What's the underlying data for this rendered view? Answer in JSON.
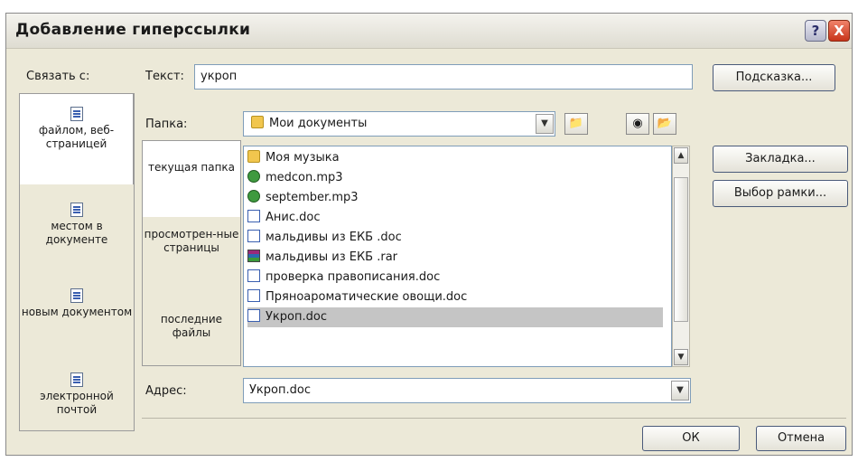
{
  "window": {
    "title": "Добавление гиперссылки",
    "help_glyph": "?",
    "close_glyph": "X"
  },
  "link_to": {
    "label": "Связать с:",
    "items": [
      {
        "label": "файлом, веб-страницей",
        "icon": "web-page-icon",
        "selected": true
      },
      {
        "label": "местом в документе",
        "icon": "place-in-document-icon",
        "selected": false
      },
      {
        "label": "новым документом",
        "icon": "new-document-icon",
        "selected": false
      },
      {
        "label": "электронной почтой",
        "icon": "email-icon",
        "selected": false
      }
    ]
  },
  "text_field": {
    "label": "Текст:",
    "value": "укроп"
  },
  "folder": {
    "label": "Папка:",
    "value": "Мои документы"
  },
  "favorites": [
    {
      "label": "текущая папка",
      "selected": true
    },
    {
      "label": "просмотрен-ные страницы",
      "selected": false
    },
    {
      "label": "последние файлы",
      "selected": false
    }
  ],
  "files": [
    {
      "name": "Моя музыка",
      "type": "folder"
    },
    {
      "name": "medcon.mp3",
      "type": "mp3"
    },
    {
      "name": "september.mp3",
      "type": "mp3"
    },
    {
      "name": "Анис.doc",
      "type": "doc"
    },
    {
      "name": "мальдивы из ЕКБ .doc",
      "type": "doc"
    },
    {
      "name": "мальдивы из ЕКБ .rar",
      "type": "rar"
    },
    {
      "name": "проверка правописания.doc",
      "type": "doc"
    },
    {
      "name": "Пряноароматические овощи.doc",
      "type": "doc"
    },
    {
      "name": "Укроп.doc",
      "type": "doc",
      "selected": true
    }
  ],
  "address": {
    "label": "Адрес:",
    "value": "Укроп.doc"
  },
  "buttons": {
    "hint": "Подсказка...",
    "bookmark": "Закладка...",
    "frame": "Выбор рамки...",
    "ok": "ОК",
    "cancel": "Отмена"
  }
}
